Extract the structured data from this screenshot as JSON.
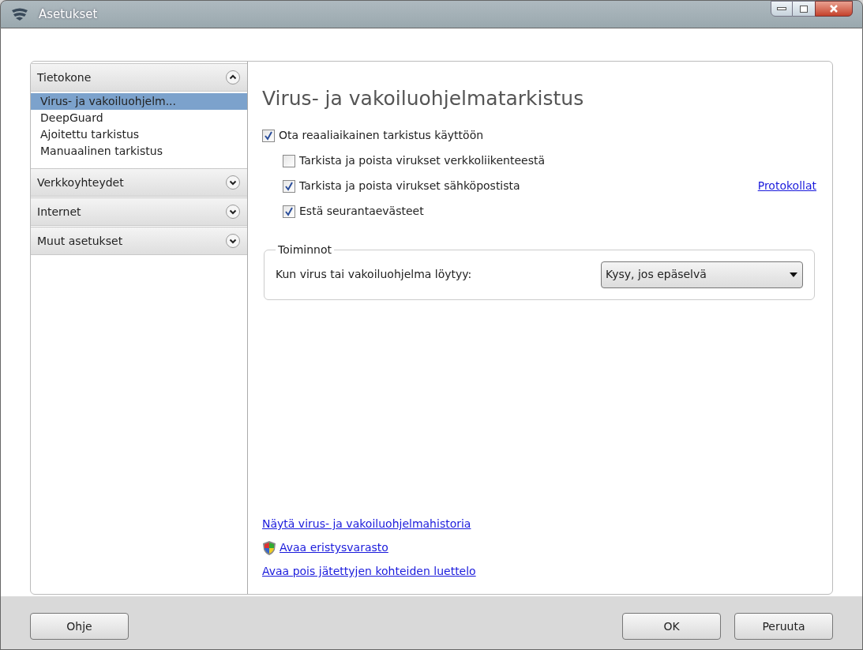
{
  "window": {
    "title": "Asetukset"
  },
  "sidebar": {
    "sections": [
      {
        "label": "Tietokone",
        "expanded": true,
        "items": [
          {
            "label": "Virus- ja vakoiluohjelm...",
            "selected": true
          },
          {
            "label": "DeepGuard",
            "selected": false
          },
          {
            "label": "Ajoitettu tarkistus",
            "selected": false
          },
          {
            "label": "Manuaalinen tarkistus",
            "selected": false
          }
        ]
      },
      {
        "label": "Verkkoyhteydet",
        "expanded": false
      },
      {
        "label": "Internet",
        "expanded": false
      },
      {
        "label": "Muut asetukset",
        "expanded": false
      }
    ]
  },
  "main": {
    "heading": "Virus- ja vakoiluohjelmatarkistus",
    "options": [
      {
        "label": "Ota reaaliaikainen tarkistus käyttöön",
        "checked": true,
        "children": [
          {
            "label": "Tarkista ja poista virukset verkkoliikenteestä",
            "checked": false
          },
          {
            "label": "Tarkista ja poista virukset sähköpostista",
            "checked": true,
            "link": "Protokollat"
          },
          {
            "label": "Estä seurantaevästeet",
            "checked": true
          }
        ]
      }
    ],
    "group": {
      "legend": "Toiminnot",
      "label": "Kun virus tai vakoiluohjelma löytyy:",
      "value": "Kysy, jos epäselvä"
    },
    "links": [
      {
        "label": "Näytä virus- ja vakoiluohjelmahistoria",
        "kind": "plain"
      },
      {
        "label": "Avaa eristysvarasto",
        "kind": "shield"
      },
      {
        "label": "Avaa pois jätettyjen kohteiden luettelo",
        "kind": "plain"
      }
    ]
  },
  "buttons": {
    "left": [
      "Ohje"
    ],
    "right": [
      "OK",
      "Peruuta"
    ]
  }
}
